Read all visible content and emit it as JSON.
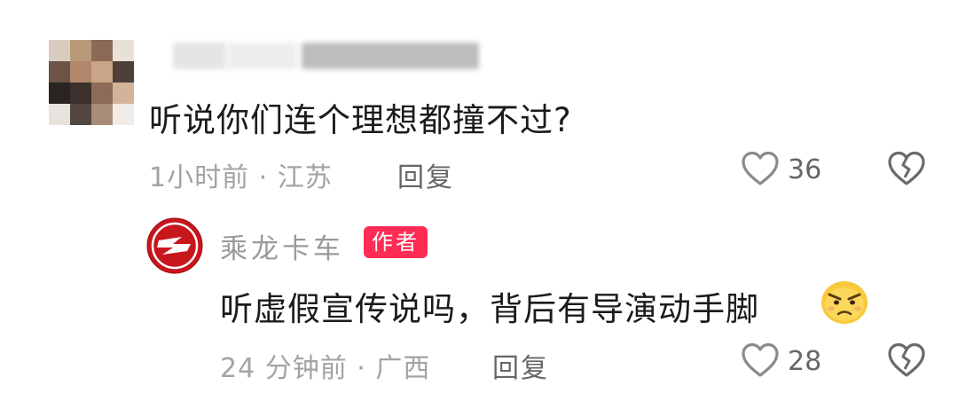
{
  "comments": [
    {
      "text": "听说你们连个理想都撞不过?",
      "time_location": "1小时前 · 江苏",
      "reply_label": "回复",
      "likes": "36"
    }
  ],
  "reply": {
    "author": "乘龙卡车",
    "badge": "作者",
    "text": "听虚假宣传说吗，背后有导演动手脚",
    "time_location": "24 分钟前 · 广西",
    "reply_label": "回复",
    "likes": "28",
    "emoji": "angry-face-emoji"
  },
  "colors": {
    "badge_bg": "#ff2d55",
    "meta_text": "#a3a3a3",
    "logo_red": "#c8161d"
  }
}
